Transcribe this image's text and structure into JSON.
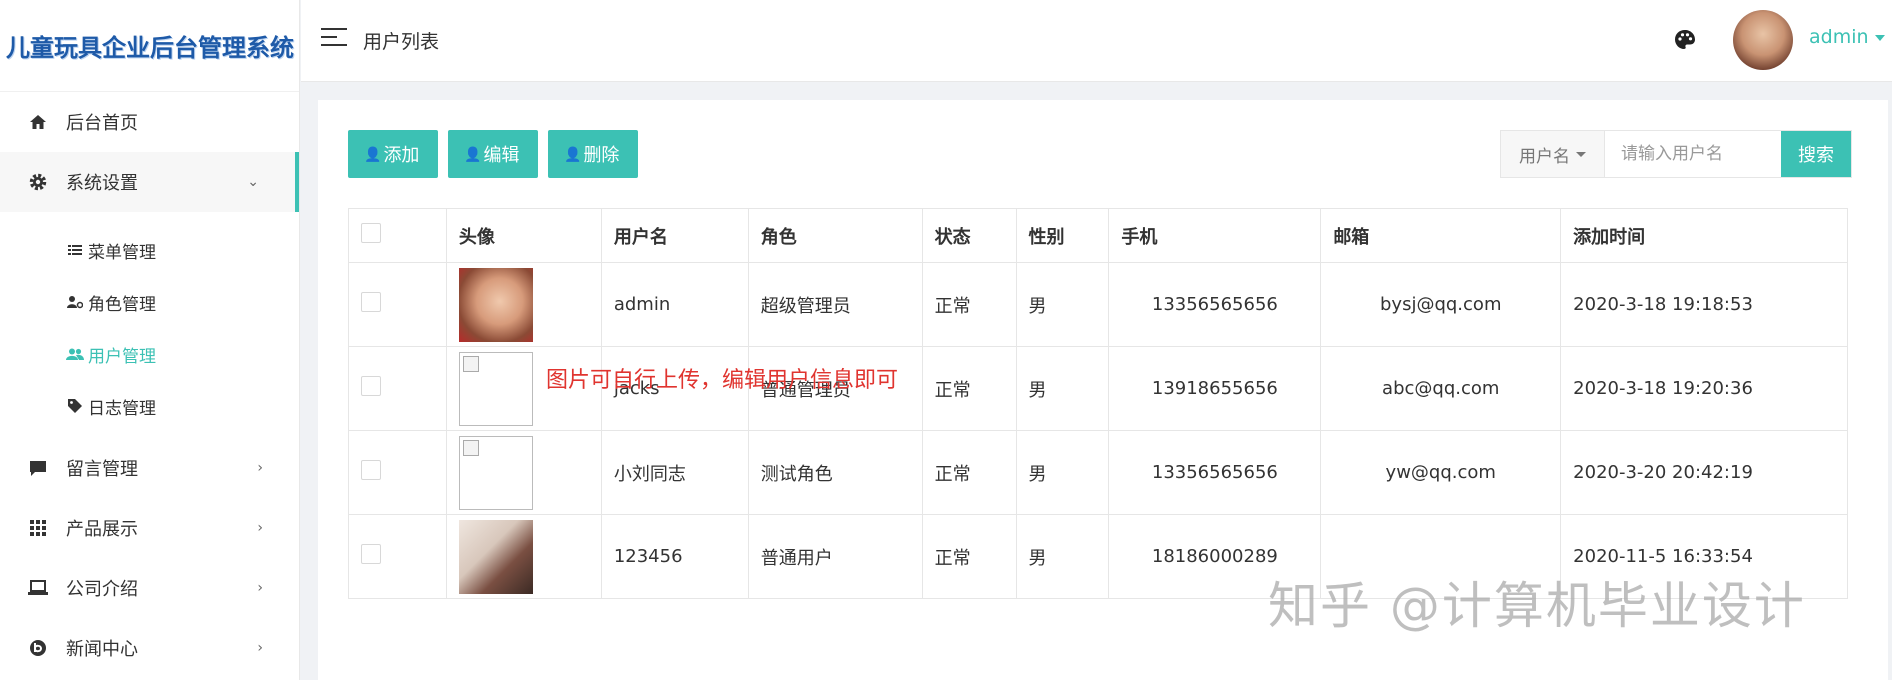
{
  "app": {
    "title": "儿童玩具企业后台管理系统"
  },
  "sidebar": {
    "items": [
      {
        "label": "后台首页",
        "icon": "home-icon"
      },
      {
        "label": "系统设置",
        "icon": "gear-icon",
        "expanded": true,
        "children": [
          {
            "label": "菜单管理",
            "icon": "list-icon"
          },
          {
            "label": "角色管理",
            "icon": "user-role-icon"
          },
          {
            "label": "用户管理",
            "icon": "users-icon",
            "active": true
          },
          {
            "label": "日志管理",
            "icon": "tag-icon"
          }
        ]
      },
      {
        "label": "留言管理",
        "icon": "comment-icon"
      },
      {
        "label": "产品展示",
        "icon": "grid-icon"
      },
      {
        "label": "公司介绍",
        "icon": "laptop-icon"
      },
      {
        "label": "新闻中心",
        "icon": "news-icon"
      }
    ]
  },
  "header": {
    "page_title": "用户列表",
    "username": "admin"
  },
  "toolbar": {
    "add_label": "添加",
    "edit_label": "编辑",
    "delete_label": "删除"
  },
  "search": {
    "field_option": "用户名",
    "placeholder": "请输入用户名",
    "button_label": "搜索"
  },
  "table": {
    "headers": [
      "头像",
      "用户名",
      "角色",
      "状态",
      "性别",
      "手机",
      "邮箱",
      "添加时间"
    ],
    "rows": [
      {
        "avatar": "photo",
        "username": "admin",
        "role": "超级管理员",
        "status": "正常",
        "gender": "男",
        "phone": "13356565656",
        "email": "bysj@qq.com",
        "time": "2020-3-18 19:18:53"
      },
      {
        "avatar": "broken",
        "username": "jacks",
        "role": "普通管理员",
        "status": "正常",
        "gender": "男",
        "phone": "13918655656",
        "email": "abc@qq.com",
        "time": "2020-3-18 19:20:36"
      },
      {
        "avatar": "broken",
        "username": "小刘同志",
        "role": "测试角色",
        "status": "正常",
        "gender": "男",
        "phone": "13356565656",
        "email": "yw@qq.com",
        "time": "2020-3-20 20:42:19"
      },
      {
        "avatar": "photo",
        "username": "123456",
        "role": "普通用户",
        "status": "正常",
        "gender": "男",
        "phone": "18186000289",
        "email": "",
        "time": "2020-11-5 16:33:54"
      }
    ]
  },
  "annotation": "图片可自行上传，编辑用户信息即可",
  "watermark": "知乎 @计算机毕业设计",
  "colors": {
    "accent": "#3cc1b4",
    "annotation_red": "#e0342f",
    "time_green": "#2ea36c"
  }
}
